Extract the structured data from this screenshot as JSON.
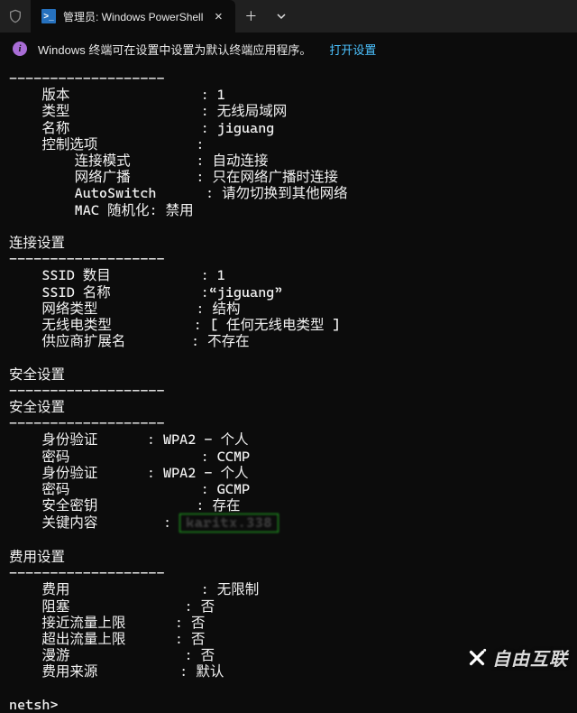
{
  "tab_title": "管理员: Windows PowerShell",
  "infobar": {
    "msg": "Windows 终端可在设置中设置为默认终端应用程序。",
    "link": "打开设置"
  },
  "sections": {
    "profile": {
      "items": [
        {
          "k": "版本",
          "v": "1"
        },
        {
          "k": "类型",
          "v": "无线局域网"
        },
        {
          "k": "名称",
          "v": "jiguang"
        },
        {
          "k": "控制选项",
          "v": ""
        },
        {
          "k": "连接模式",
          "v": "自动连接",
          "sub": true
        },
        {
          "k": "网络广播",
          "v": "只在网络广播时连接",
          "sub": true
        },
        {
          "k": "AutoSwitch",
          "v": "请勿切换到其他网络",
          "sub": true
        },
        {
          "k": "MAC 随机化: 禁用",
          "v": null,
          "sub": true
        }
      ]
    },
    "connection": {
      "title": "连接设置",
      "items": [
        {
          "k": "SSID 数目",
          "v": "1"
        },
        {
          "k": "SSID 名称",
          "v": "“jiguang”",
          "sep": ":",
          "nospace": true
        },
        {
          "k": "网络类型",
          "v": "结构"
        },
        {
          "k": "无线电类型",
          "v": "[ 任何无线电类型 ]"
        },
        {
          "k": "供应商扩展名",
          "v": "不存在"
        }
      ]
    },
    "security": {
      "title": "安全设置",
      "items": [
        {
          "k": "身份验证",
          "v": "WPA2 - 个人",
          "col": 18
        },
        {
          "k": "密码",
          "v": "CCMP",
          "col": 24
        },
        {
          "k": "身份验证",
          "v": "WPA2 - 个人",
          "col": 18
        },
        {
          "k": "密码",
          "v": "GCMP",
          "col": 24
        },
        {
          "k": "安全密钥",
          "v": "存在",
          "col": 24
        },
        {
          "k": "关键内容",
          "v": "",
          "col": 20,
          "hl": "karitx.338"
        }
      ]
    },
    "cost": {
      "title": "费用设置",
      "items": [
        {
          "k": "费用",
          "v": "无限制"
        },
        {
          "k": "阻塞",
          "v": "否",
          "col": 22
        },
        {
          "k": "接近流量上限",
          "v": "否",
          "col": 22
        },
        {
          "k": "超出流量上限",
          "v": "否",
          "col": 22
        },
        {
          "k": "漫游",
          "v": "否",
          "col": 22
        },
        {
          "k": "费用来源",
          "v": "默认",
          "col": 22
        }
      ]
    }
  },
  "prompt": "netsh>",
  "watermark": "自由互联"
}
